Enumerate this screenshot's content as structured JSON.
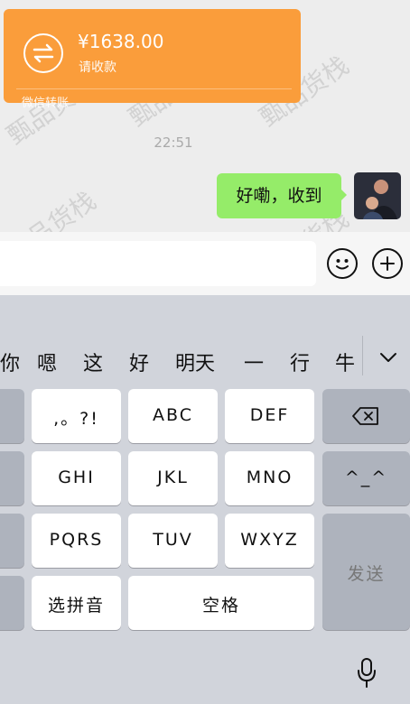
{
  "transfer": {
    "amount": "¥1638.00",
    "subtitle": "请收款",
    "footer": "微信转账"
  },
  "chat": {
    "time": "22:51",
    "my_message": "好嘞，收到"
  },
  "candidates": [
    "你",
    "嗯",
    "这",
    "好",
    "明天",
    "一",
    "行",
    "牛"
  ],
  "keys": {
    "punct": ",。?!",
    "abc": "ABC",
    "def": "DEF",
    "ghi": "GHI",
    "jkl": "JKL",
    "mno": "MNO",
    "emoticon": "^_^",
    "pqrs": "PQRS",
    "tuv": "TUV",
    "wxyz": "WXYZ",
    "send": "发送",
    "pinyin_select": "选拼音",
    "space": "空格"
  },
  "watermark": "甄品货栈",
  "colors": {
    "transfer_card": "#fa9d3b",
    "my_bubble": "#95ec69",
    "keyboard_bg": "#d1d4db"
  }
}
